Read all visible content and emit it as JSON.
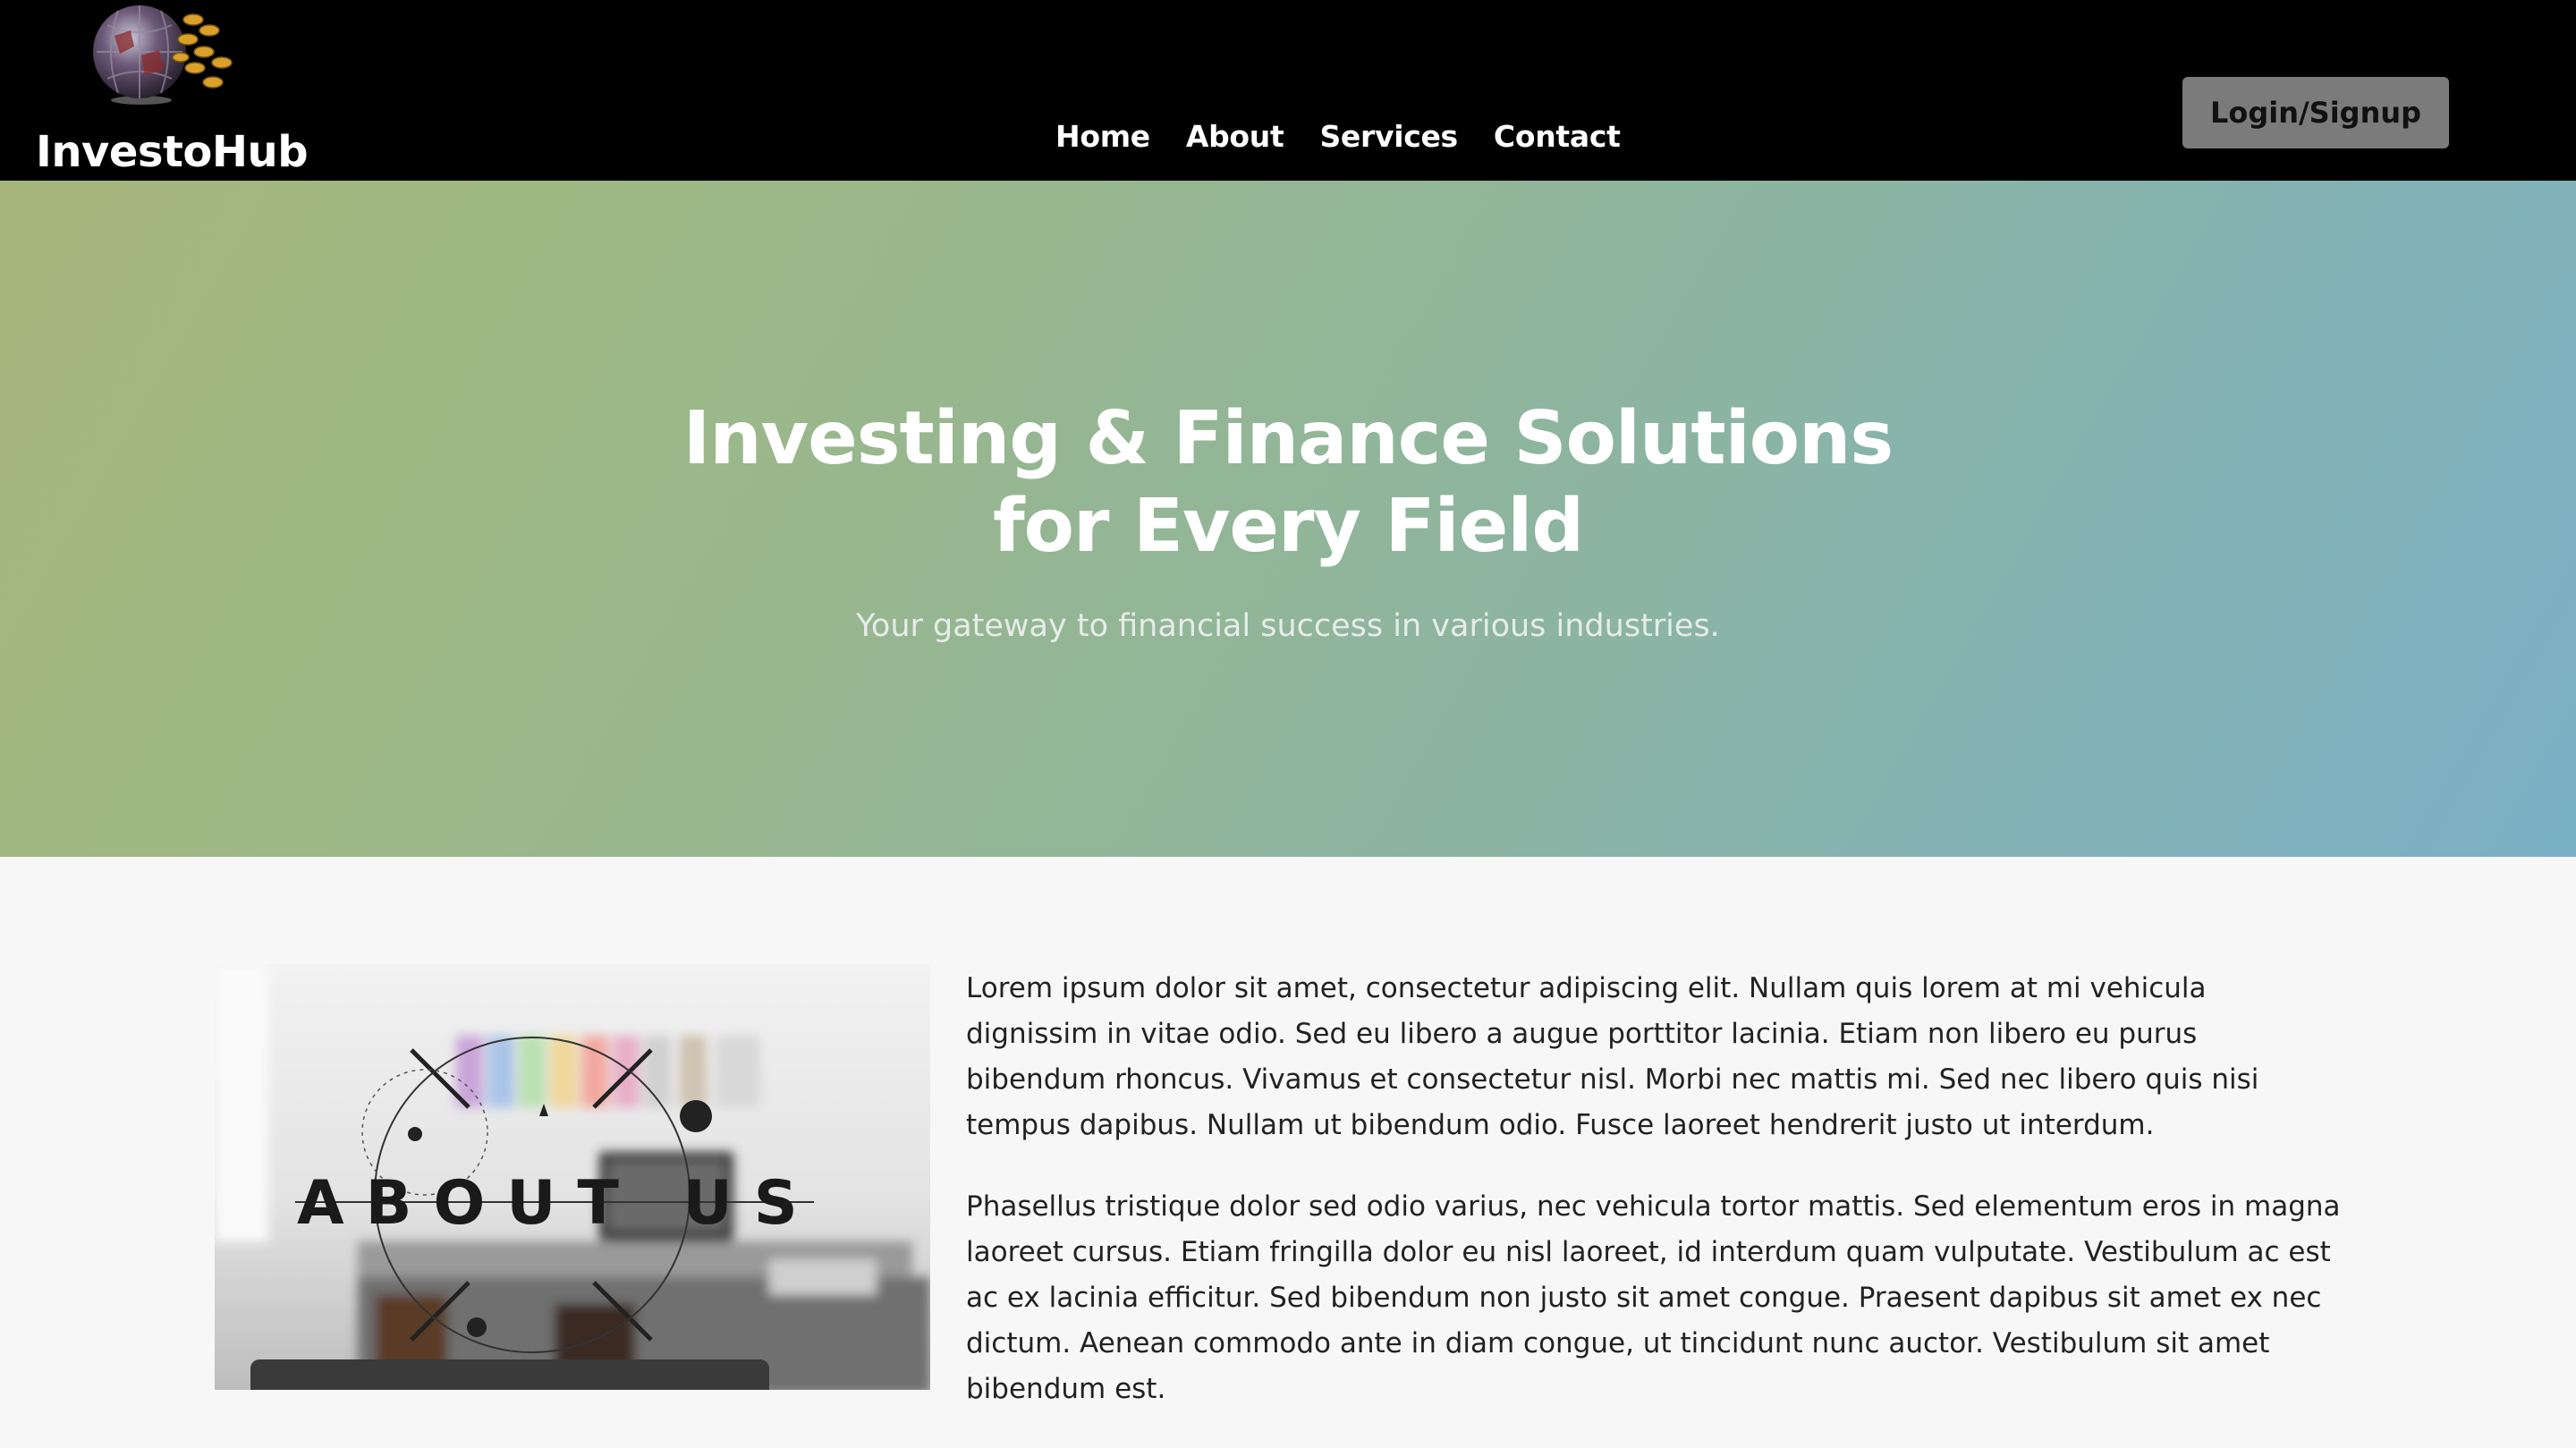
{
  "header": {
    "brand": "InvestoHub",
    "logo": "globe-coins-logo",
    "nav": [
      "Home",
      "About",
      "Services",
      "Contact"
    ],
    "login_label": "Login/Signup"
  },
  "hero": {
    "title_line1": "Investing & Finance Solutions",
    "title_line2": "for Every Field",
    "subtitle": "Your gateway to financial success in various industries."
  },
  "about": {
    "image_caption": "ABOUT US",
    "paragraphs": [
      "Lorem ipsum dolor sit amet, consectetur adipiscing elit. Nullam quis lorem at mi vehicula dignissim in vitae odio. Sed eu libero a augue porttitor lacinia. Etiam non libero eu purus bibendum rhoncus. Vivamus et consectetur nisl. Morbi nec mattis mi. Sed nec libero quis nisi tempus dapibus. Nullam ut bibendum odio. Fusce laoreet hendrerit justo ut interdum.",
      "Phasellus tristique dolor sed odio varius, nec vehicula tortor mattis. Sed elementum eros in magna laoreet cursus. Etiam fringilla dolor eu nisl laoreet, id interdum quam vulputate. Vestibulum ac est ac ex lacinia efficitur. Sed bibendum non justo sit amet congue. Praesent dapibus sit amet ex nec dictum. Aenean commodo ante in diam congue, ut tincidunt nunc auctor. Vestibulum sit amet bibendum est."
    ]
  },
  "colors": {
    "header_bg": "#000000",
    "hero_gradient_start": "#a7b77c",
    "hero_gradient_end": "#7ab0c6",
    "login_bg": "#7b7b7b",
    "page_bg": "#f7f7f7"
  }
}
